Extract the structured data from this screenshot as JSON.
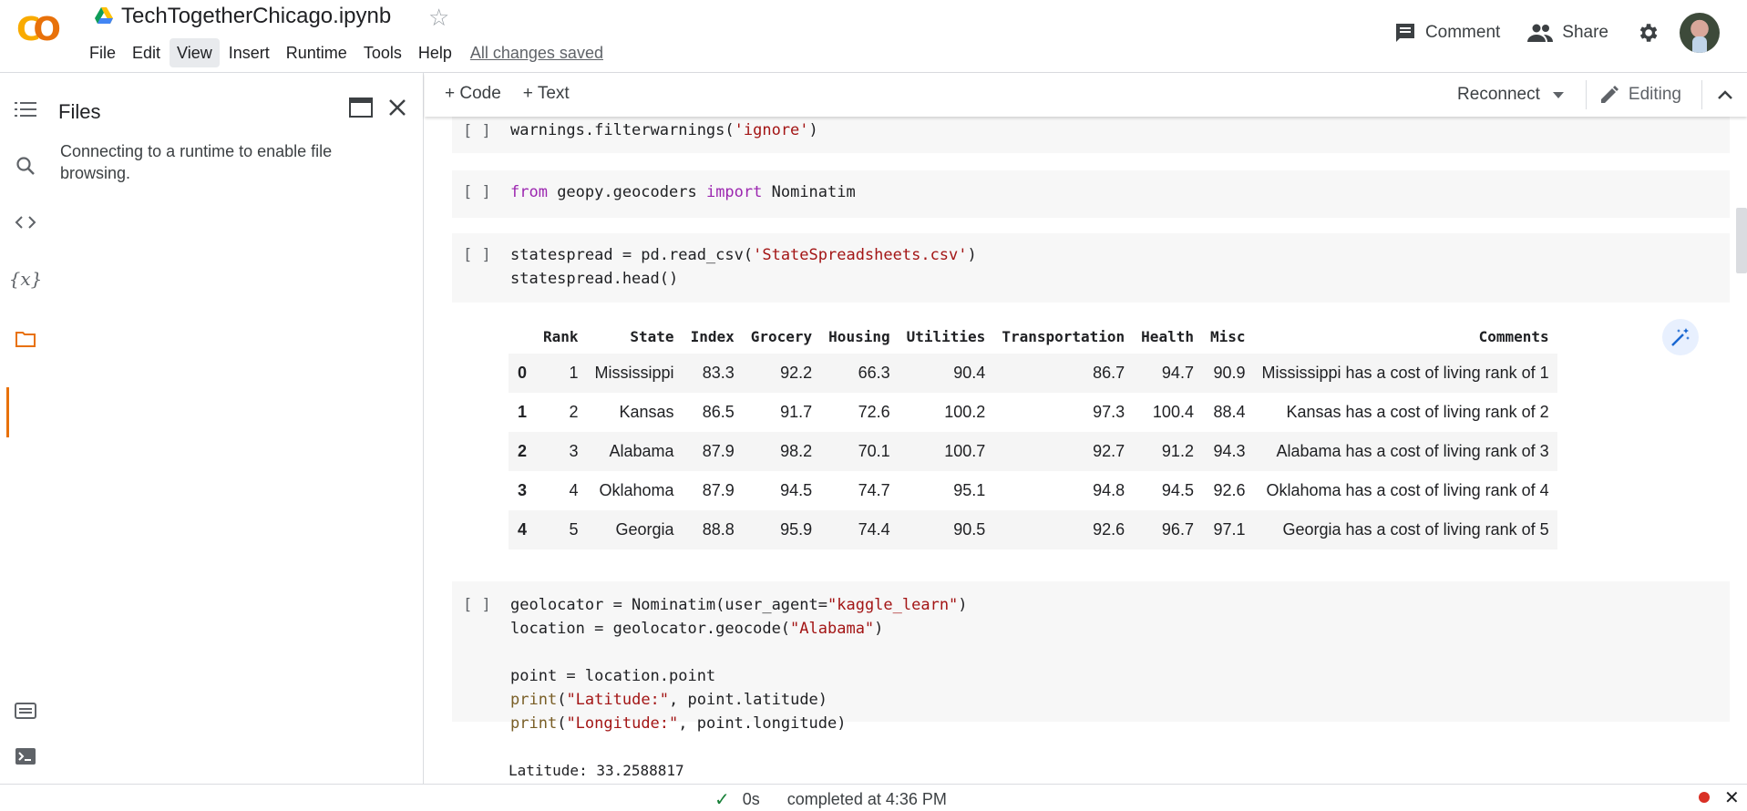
{
  "app": {
    "title": "TechTogetherChicago.ipynb",
    "logo_text": "CO"
  },
  "menu": {
    "items": [
      "File",
      "Edit",
      "View",
      "Insert",
      "Runtime",
      "Tools",
      "Help"
    ],
    "active": "View",
    "saved_status": "All changes saved"
  },
  "header_actions": {
    "comment_label": "Comment",
    "share_label": "Share"
  },
  "left_rail": {
    "icons": [
      "toc-icon",
      "search-icon",
      "code-snippets-icon",
      "variables-icon",
      "folder-icon",
      "command-palette-icon",
      "terminal-icon"
    ],
    "active": "folder-icon"
  },
  "files_panel": {
    "title": "Files",
    "message": "Connecting to a runtime to enable file browsing."
  },
  "toolbar": {
    "add_code": "+ Code",
    "add_text": "+ Text",
    "reconnect": "Reconnect",
    "editing": "Editing"
  },
  "cells": [
    {
      "bracket": "[ ]",
      "code": "warnings.filterwarnings('ignore')"
    },
    {
      "bracket": "[ ]",
      "code": "from geopy.geocoders import Nominatim"
    },
    {
      "bracket": "[ ]",
      "code": "statespread = pd.read_csv('StateSpreadsheets.csv')\nstatespread.head()"
    },
    {
      "bracket": "[ ]",
      "code": "geolocator = Nominatim(user_agent=\"kaggle_learn\")\nlocation = geolocator.geocode(\"Alabama\")\n\npoint = location.point\nprint(\"Latitude:\", point.latitude)\nprint(\"Longitude:\", point.longitude)"
    }
  ],
  "dataframe": {
    "columns": [
      "",
      "Rank",
      "State",
      "Index",
      "Grocery",
      "Housing",
      "Utilities",
      "Transportation",
      "Health",
      "Misc",
      "Comments"
    ],
    "rows": [
      [
        "0",
        "1",
        "Mississippi",
        "83.3",
        "92.2",
        "66.3",
        "90.4",
        "86.7",
        "94.7",
        "90.9",
        "Mississippi has a cost of living rank of 1"
      ],
      [
        "1",
        "2",
        "Kansas",
        "86.5",
        "91.7",
        "72.6",
        "100.2",
        "97.3",
        "100.4",
        "88.4",
        "Kansas has a cost of living rank of 2"
      ],
      [
        "2",
        "3",
        "Alabama",
        "87.9",
        "98.2",
        "70.1",
        "100.7",
        "92.7",
        "91.2",
        "94.3",
        "Alabama has a cost of living rank of 3"
      ],
      [
        "3",
        "4",
        "Oklahoma",
        "87.9",
        "94.5",
        "74.7",
        "95.1",
        "94.8",
        "94.5",
        "92.6",
        "Oklahoma has a cost of living rank of 4"
      ],
      [
        "4",
        "5",
        "Georgia",
        "88.8",
        "95.9",
        "74.4",
        "90.5",
        "92.6",
        "96.7",
        "97.1",
        "Georgia has a cost of living rank of 5"
      ]
    ]
  },
  "output_text": "Latitude: 33.2588817",
  "status": {
    "duration": "0s",
    "completed": "completed at 4:36 PM"
  },
  "colors": {
    "accent": "#e8710a",
    "keyword": "#9c27b0",
    "string": "#a31515",
    "success": "#188038"
  }
}
